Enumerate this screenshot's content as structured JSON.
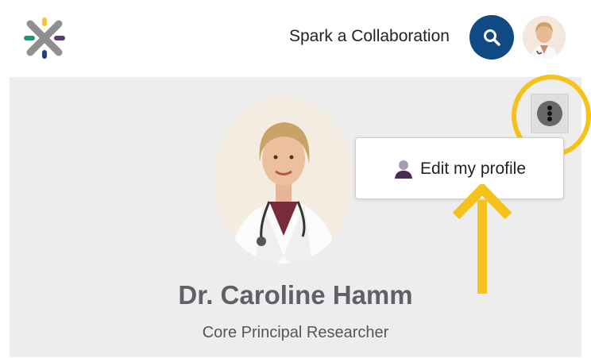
{
  "header": {
    "cta_label": "Spark a Collaboration",
    "logo_icon": "spark-x-logo",
    "search_icon": "search-icon",
    "avatar_icon": "user-avatar"
  },
  "profile": {
    "name": "Dr. Caroline Hamm",
    "role": "Core Principal Researcher",
    "photo_icon": "profile-photo"
  },
  "menu": {
    "more_icon": "more-vertical-icon",
    "items": [
      {
        "label": "Edit my profile",
        "icon": "person-icon"
      }
    ]
  },
  "annotation": {
    "highlight_color": "#f4c21a"
  },
  "colors": {
    "brand_blue": "#0f4a84",
    "panel_bg": "#ededed",
    "logo_yellow": "#f6c33a",
    "logo_purple": "#5c3a7c",
    "logo_blue": "#1d3f80",
    "logo_teal": "#18987b",
    "logo_grey": "#8f8f8f"
  }
}
